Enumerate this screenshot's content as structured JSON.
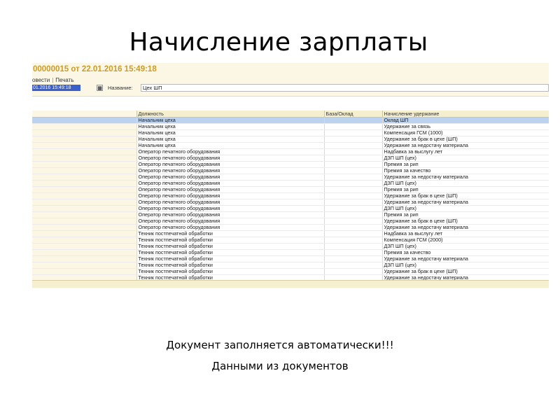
{
  "slide": {
    "title": "Начисление зарплаты",
    "caption_line1": "Документ заполняется автоматически!!!",
    "caption_line2": "Данными из документов"
  },
  "document": {
    "header": "00000015 от 22.01.2016 15:49:18",
    "toolbar": {
      "post_label": "овести",
      "separator": "|",
      "print_label": "Печать"
    },
    "date_value": "01.2016 15:49:18",
    "name_label": "Название:",
    "name_value": "Цех ШП"
  },
  "table": {
    "columns": [
      "",
      "Должность",
      "База/Оклад",
      "Начисление удержание"
    ],
    "selected_row": 0,
    "rows": [
      {
        "position": "Начальник цеха",
        "base": "",
        "accrual": "Оклад ШП"
      },
      {
        "position": "Начальник цеха",
        "base": "",
        "accrual": "Удержание за связь"
      },
      {
        "position": "Начальник цеха",
        "base": "",
        "accrual": "Компенсация ГСМ (1000)"
      },
      {
        "position": "Начальник цеха",
        "base": "",
        "accrual": "Удержание за брак в цехе (ШП)"
      },
      {
        "position": "Начальник цеха",
        "base": "",
        "accrual": "Удержание за недостачу материала"
      },
      {
        "position": "Оператор печатного оборудования",
        "base": "",
        "accrual": "Надбавка за выслугу лет"
      },
      {
        "position": "Оператор печатного оборудования",
        "base": "",
        "accrual": "ДЗП ШП (цех)"
      },
      {
        "position": "Оператор печатного оборудования",
        "base": "",
        "accrual": "Премия за рип"
      },
      {
        "position": "Оператор печатного оборудования",
        "base": "",
        "accrual": "Премия за качество"
      },
      {
        "position": "Оператор печатного оборудования",
        "base": "",
        "accrual": "Удержание за недостачу материала"
      },
      {
        "position": "Оператор печатного оборудования",
        "base": "",
        "accrual": "ДЗП ШП (цех)"
      },
      {
        "position": "Оператор печатного оборудования",
        "base": "",
        "accrual": "Премия за рип"
      },
      {
        "position": "Оператор печатного оборудования",
        "base": "",
        "accrual": "Удержание за брак в цехе (ШП)"
      },
      {
        "position": "Оператор печатного оборудования",
        "base": "",
        "accrual": "Удержание за недостачу материала"
      },
      {
        "position": "Оператор печатного оборудования",
        "base": "",
        "accrual": "ДЗП ШП (цех)"
      },
      {
        "position": "Оператор печатного оборудования",
        "base": "",
        "accrual": "Премия за рип"
      },
      {
        "position": "Оператор печатного оборудования",
        "base": "",
        "accrual": "Удержание за брак в цехе (ШП)"
      },
      {
        "position": "Оператор печатного оборудования",
        "base": "",
        "accrual": "Удержание за недостачу материала"
      },
      {
        "position": "Техник постпечатной обработки",
        "base": "",
        "accrual": "Надбавка за выслугу лет"
      },
      {
        "position": "Техник постпечатной обработки",
        "base": "",
        "accrual": "Компенсация ГСМ (2000)"
      },
      {
        "position": "Техник постпечатной обработки",
        "base": "",
        "accrual": "ДЗП ШП (цех)"
      },
      {
        "position": "Техник постпечатной обработки",
        "base": "",
        "accrual": "Премия за качество"
      },
      {
        "position": "Техник постпечатной обработки",
        "base": "",
        "accrual": "Удержание за недостачу материала"
      },
      {
        "position": "Техник постпечатной обработки",
        "base": "",
        "accrual": "ДЗП ШП (цех)"
      },
      {
        "position": "Техник постпечатной обработки",
        "base": "",
        "accrual": "Удержание за брак в цехе (ШП)"
      },
      {
        "position": "Техник постпечатной обработки",
        "base": "",
        "accrual": "Удержание за недостачу материала"
      }
    ]
  },
  "colors": {
    "header_text": "#c99c2a",
    "selection": "#bcd3ef",
    "date_field": "#3a5fc8",
    "panel_bg": "#fbf7e4"
  },
  "icons": {
    "calendar": "calendar-icon"
  }
}
